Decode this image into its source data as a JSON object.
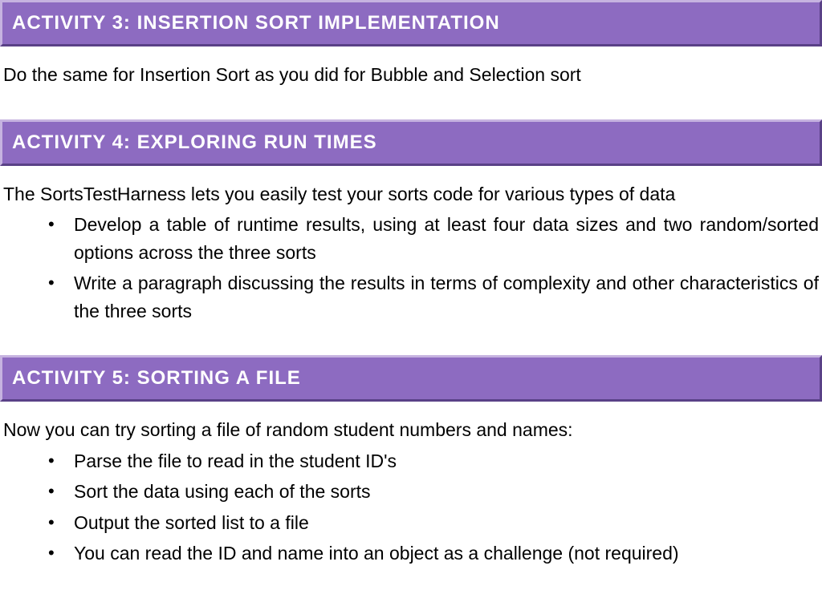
{
  "activities": [
    {
      "title": "ACTIVITY 3: INSERTION SORT IMPLEMENTATION",
      "intro": "Do the same for Insertion Sort as you did for Bubble and Selection sort",
      "bullets": []
    },
    {
      "title": "ACTIVITY 4: EXPLORING RUN TIMES",
      "intro": "The SortsTestHarness lets you easily test your sorts code for various types of data",
      "bullets": [
        "Develop a table of runtime results, using at least four data sizes and two random/sorted options across the three sorts",
        "Write a paragraph discussing the results in terms of complexity and other characteristics of the three sorts"
      ],
      "bullets_justify": true
    },
    {
      "title": "ACTIVITY 5: SORTING A FILE",
      "intro": "Now you can try sorting a file of random student numbers and names:",
      "bullets": [
        "Parse the file to read in the student ID's",
        "Sort the data using each of the sorts",
        "Output the sorted list to a file",
        "You can read the ID and name into an object as a challenge (not required)"
      ],
      "bullets_justify": false
    }
  ]
}
